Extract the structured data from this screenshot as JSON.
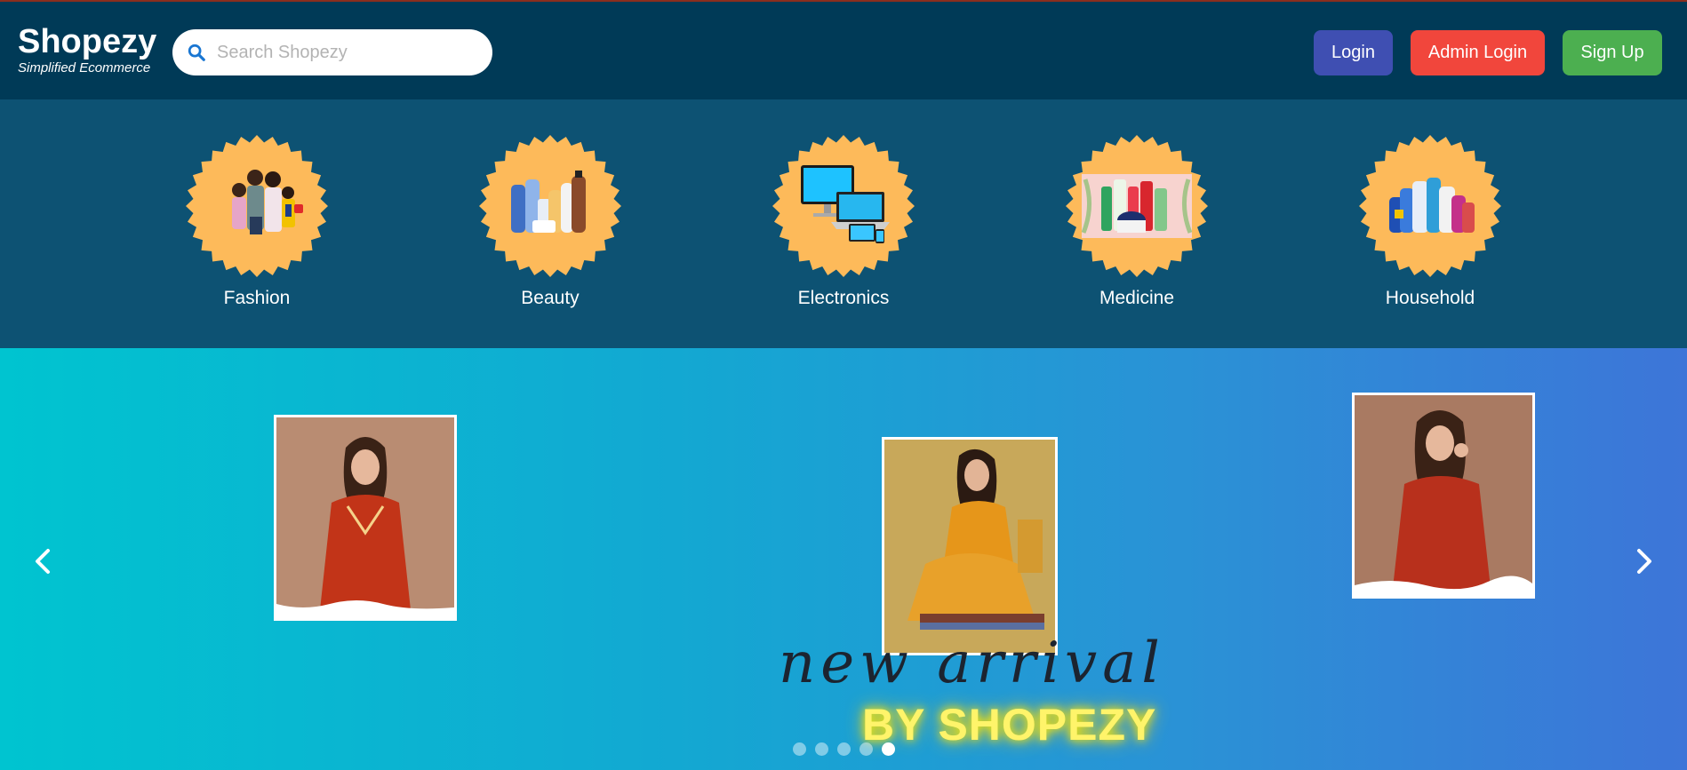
{
  "header": {
    "brand_name": "Shopezy",
    "brand_tagline": "Simplified Ecommerce",
    "search_placeholder": "Search Shopezy",
    "login_label": "Login",
    "admin_login_label": "Admin Login",
    "signup_label": "Sign Up",
    "colors": {
      "bar": "#003a57",
      "login": "#3f4fb2",
      "admin": "#f1463c",
      "signup": "#4caf50"
    }
  },
  "categories": [
    {
      "label": "Fashion",
      "icon": "fashion-family-image"
    },
    {
      "label": "Beauty",
      "icon": "beauty-products-image"
    },
    {
      "label": "Electronics",
      "icon": "electronics-devices-image"
    },
    {
      "label": "Medicine",
      "icon": "medicine-products-image"
    },
    {
      "label": "Household",
      "icon": "household-cleaners-image"
    }
  ],
  "carousel": {
    "script_text": "new arrivals",
    "tagline": "BY SHOPEZY",
    "slide_count": 5,
    "active_slide": 5,
    "prev_icon": "chevron-left-icon",
    "next_icon": "chevron-right-icon"
  },
  "colors": {
    "badge": "#fdba5a",
    "strip": "#0d5273"
  }
}
